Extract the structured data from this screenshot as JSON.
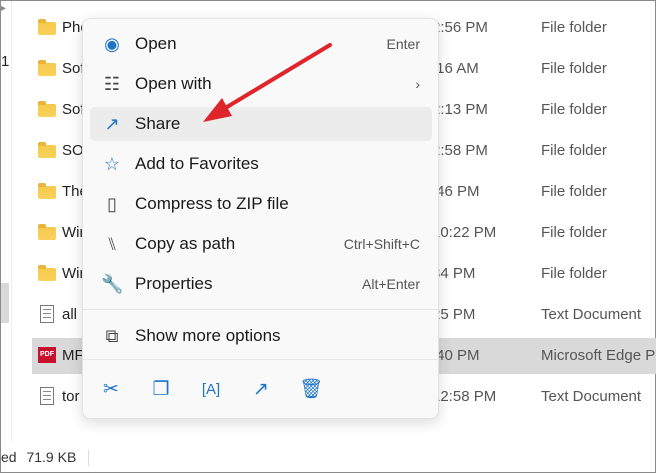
{
  "status": {
    "size": "71.9 KB",
    "prefix": "ed"
  },
  "left_marker": "1",
  "rows": [
    {
      "name": "Pho",
      "time": "2:56 PM",
      "type": "File folder",
      "icon": "folder"
    },
    {
      "name": "Sof",
      "time": ":16 AM",
      "type": "File folder",
      "icon": "folder"
    },
    {
      "name": "Sof",
      "time": "2:13 PM",
      "type": "File folder",
      "icon": "folder"
    },
    {
      "name": "SO",
      "time": "2:58 PM",
      "type": "File folder",
      "icon": "folder"
    },
    {
      "name": "The",
      "time": ":46 PM",
      "type": "File folder",
      "icon": "folder"
    },
    {
      "name": "Wir",
      "time": "10:22 PM",
      "type": "File folder",
      "icon": "folder"
    },
    {
      "name": "Wir",
      "time": "34 PM",
      "type": "File folder",
      "icon": "folder"
    },
    {
      "name": "all",
      "time": "25 PM",
      "type": "Text Document",
      "icon": "text"
    },
    {
      "name": "MF",
      "time": ":40 PM",
      "type": "Microsoft Edge PD",
      "icon": "pdf",
      "selected": true
    },
    {
      "name": "tor",
      "time": "12:58 PM",
      "type": "Text Document",
      "icon": "text"
    }
  ],
  "pdf_label": "PDF",
  "menu": {
    "items": [
      {
        "label": "Open",
        "shortcut": "Enter",
        "icon": "edge-icon"
      },
      {
        "label": "Open with",
        "shortcut": "›",
        "icon": "open-with-icon"
      },
      {
        "label": "Share",
        "shortcut": "",
        "icon": "share-icon"
      },
      {
        "label": "Add to Favorites",
        "shortcut": "",
        "icon": "star-icon"
      },
      {
        "label": "Compress to ZIP file",
        "shortcut": "",
        "icon": "zip-icon"
      },
      {
        "label": "Copy as path",
        "shortcut": "Ctrl+Shift+C",
        "icon": "copy-path-icon"
      },
      {
        "label": "Properties",
        "shortcut": "Alt+Enter",
        "icon": "wrench-icon"
      }
    ],
    "more": {
      "label": "Show more options",
      "icon": "show-more-icon"
    },
    "bottom": [
      "cut-icon",
      "copy-icon",
      "rename-icon",
      "share-icon",
      "delete-icon"
    ]
  },
  "colors": {
    "accent": "#1f74c6",
    "arrow": "#e0242b",
    "selected": "#d9d9d9"
  }
}
